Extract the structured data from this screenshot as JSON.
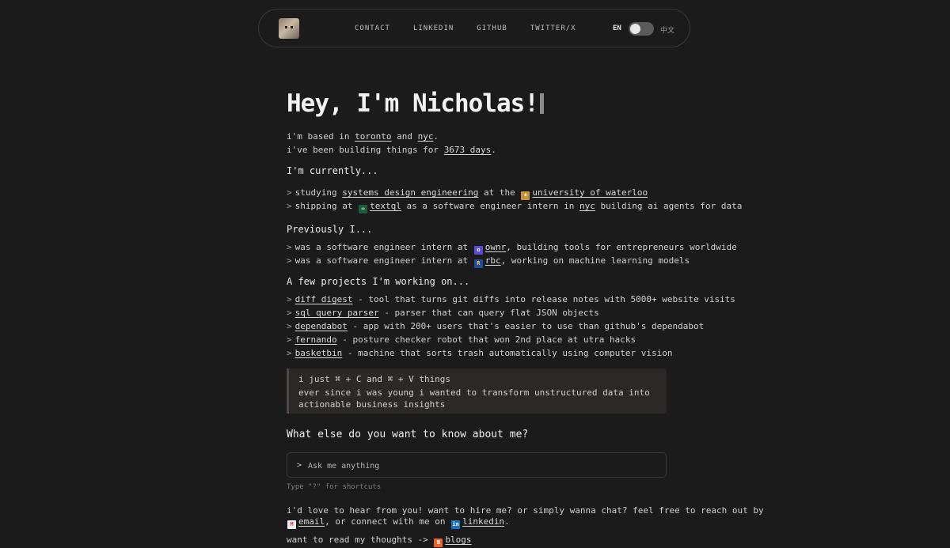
{
  "nav": {
    "links": [
      "CONTACT",
      "LINKEDIN",
      "GITHUB",
      "TWITTER/X"
    ],
    "lang_en": "EN",
    "lang_zh": "中文"
  },
  "hero": {
    "title": "Hey, I'm Nicholas!"
  },
  "intro": {
    "l1_pre": "i'm based in ",
    "toronto": "toronto",
    "l1_mid": " and ",
    "nyc": "nyc",
    "l1_end": ".",
    "l2_pre": "i've been building things for ",
    "days": "3673 days",
    "l2_end": "."
  },
  "currently": {
    "heading": "I'm currently...",
    "i1": {
      "pre": "studying ",
      "link1": "systems design engineering",
      "mid": " at the ",
      "link2": "university of waterloo"
    },
    "i2": {
      "pre": "shipping at ",
      "link1": "textql",
      "mid": " as a software engineer intern in ",
      "link2": "nyc",
      "end": " building ai agents for data"
    }
  },
  "previously": {
    "heading": "Previously I...",
    "i1": {
      "pre": "was a software engineer intern at ",
      "link": "ownr",
      "end": ", building tools for entrepreneurs worldwide"
    },
    "i2": {
      "pre": "was a software engineer intern at ",
      "link": "rbc",
      "end": ", working on machine learning models"
    }
  },
  "projects": {
    "heading": "A few projects I'm working on...",
    "items": [
      {
        "name": "diff digest",
        "desc": " - tool that turns git diffs into release notes with 5000+ website visits"
      },
      {
        "name": "sql query parser",
        "desc": " - parser that can query flat JSON objects"
      },
      {
        "name": "dependabot",
        "desc": " - app with 200+ users that's easier to use than github's dependabot"
      },
      {
        "name": "fernando",
        "desc": " - posture checker robot that won 2nd place at utra hacks"
      },
      {
        "name": "basketbin",
        "desc": " - machine that sorts trash automatically using computer vision"
      }
    ]
  },
  "quote": {
    "line1": "i just ⌘ + C and ⌘ + V things",
    "line2": "ever since i was young i wanted to transform unstructured data into actionable business insights"
  },
  "ask": {
    "heading": "What else do you want to know about me?",
    "prompt": ">",
    "placeholder": "Ask me anything",
    "hint": "Type \"?\" for shortcuts"
  },
  "contact": {
    "l1": "i'd love to hear from you! want to hire me? or simply wanna chat? feel free to reach out by",
    "email": "email",
    "mid": ", or connect with me on ",
    "linkedin": "linkedin",
    "end": "."
  },
  "blog": {
    "pre": "want to read my thoughts -> ",
    "link": "blogs"
  },
  "colors": {
    "background": "#1b1b1b",
    "quote_bg": "#2b2827",
    "text": "#cfcfcf"
  },
  "icons": {
    "waterloo": "shield-icon",
    "textql": "textql-logo-icon",
    "ownr": "ownr-logo-icon",
    "rbc": "rbc-logo-icon",
    "email": "gmail-icon",
    "linkedin": "linkedin-icon",
    "blog": "blog-icon"
  }
}
